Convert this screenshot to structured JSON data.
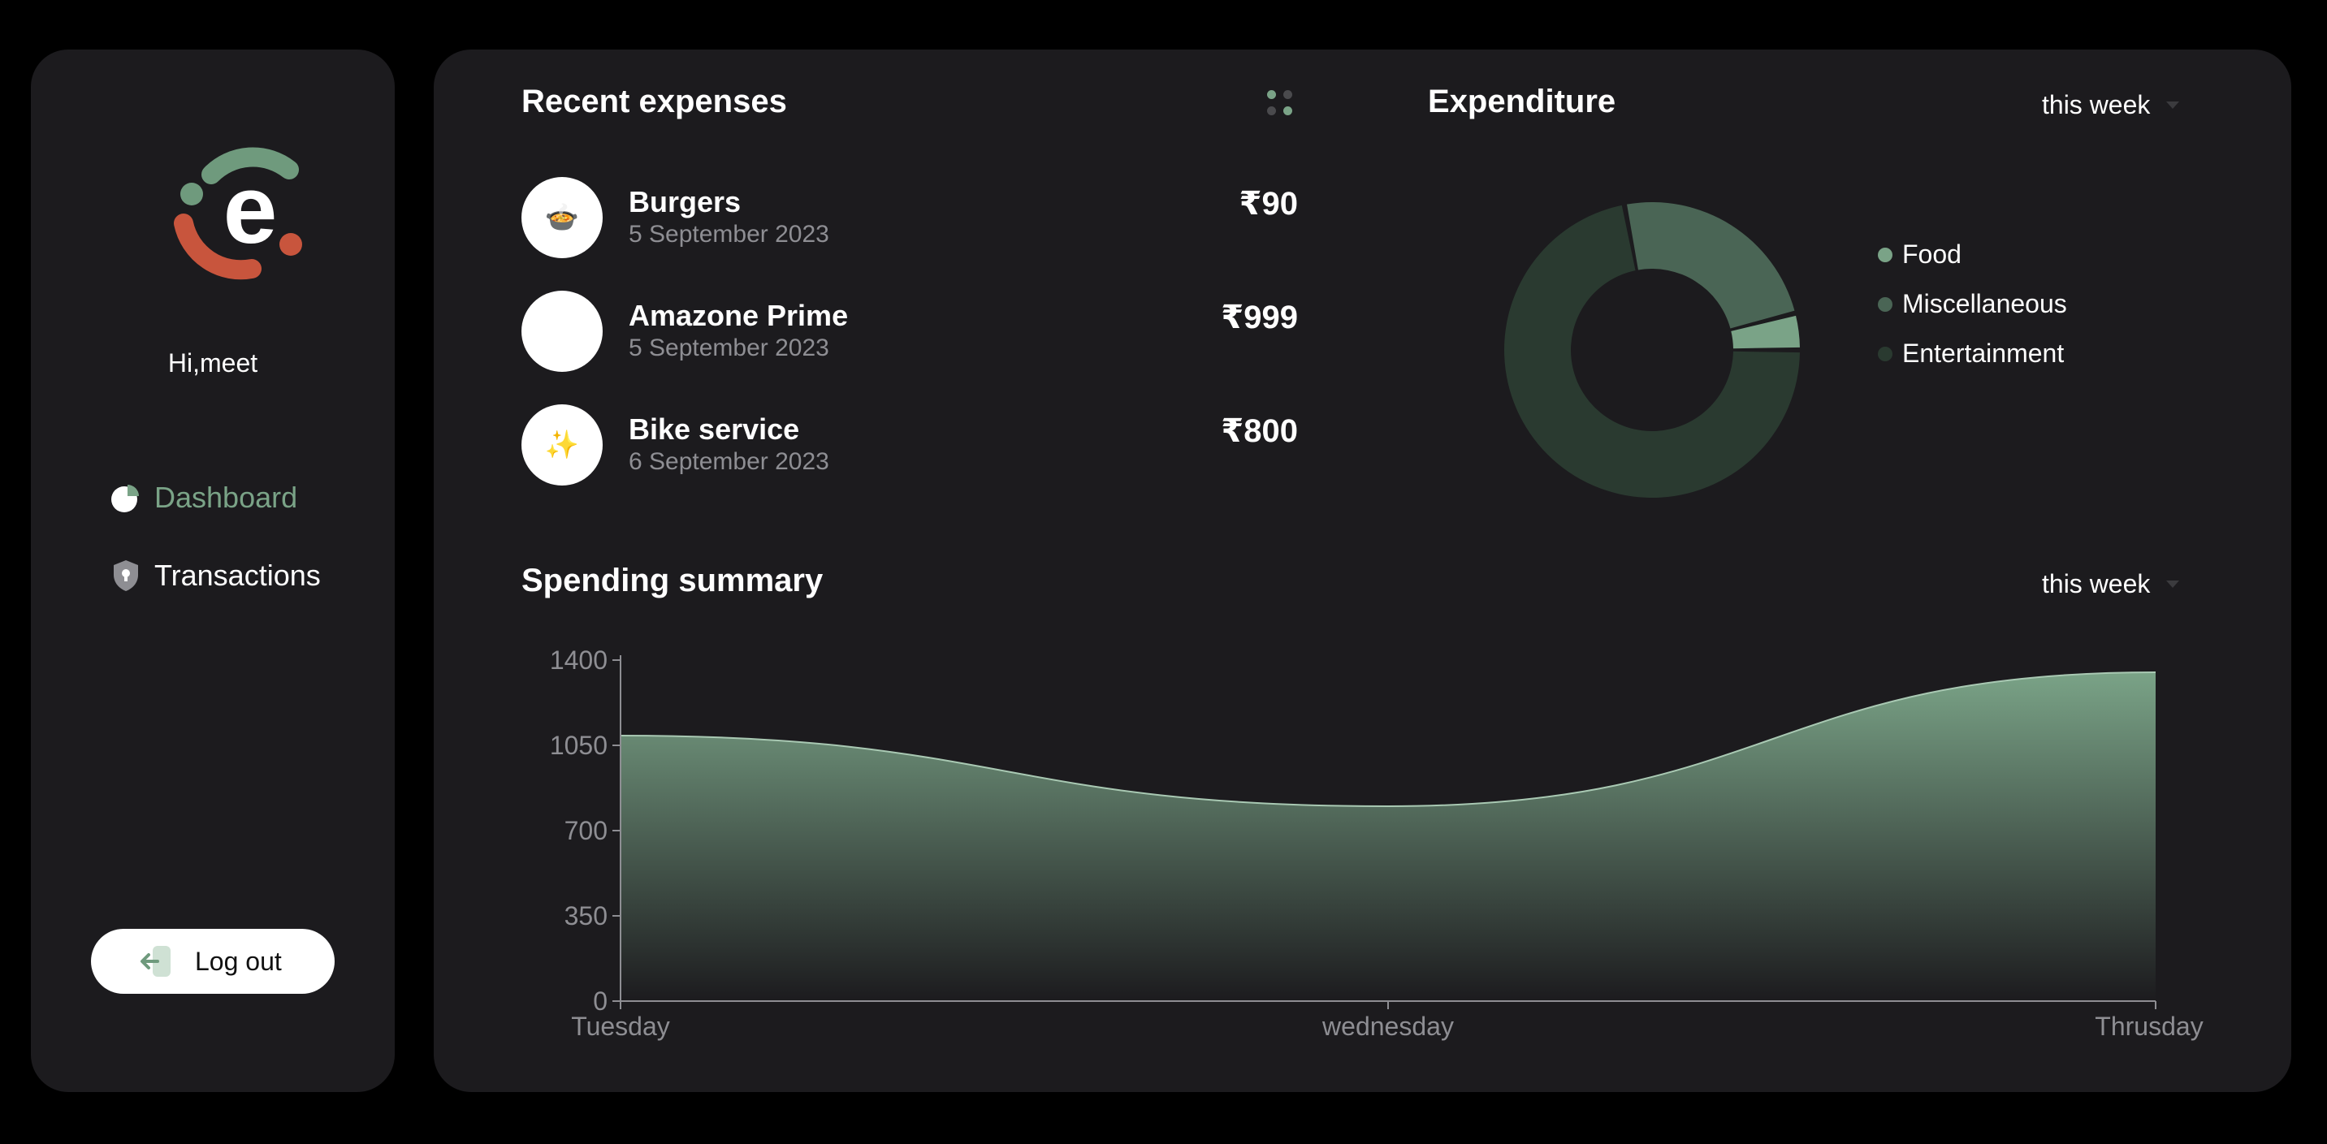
{
  "user": {
    "greeting": "Hi,meet"
  },
  "nav": {
    "items": [
      {
        "label": "Dashboard",
        "active": true,
        "icon": "pie-chart-icon"
      },
      {
        "label": "Transactions",
        "active": false,
        "icon": "shield-icon"
      }
    ]
  },
  "logout": {
    "label": "Log out",
    "icon": "logout-icon"
  },
  "recent_expenses": {
    "title": "Recent expenses",
    "items": [
      {
        "name": "Burgers",
        "date": "5 September 2023",
        "amount": "₹90",
        "icon": "🍲"
      },
      {
        "name": "Amazone Prime",
        "date": "5 September 2023",
        "amount": "₹999",
        "icon": "🎟"
      },
      {
        "name": "Bike service",
        "date": "6 September 2023",
        "amount": "₹800",
        "icon": "✨"
      }
    ]
  },
  "expenditure": {
    "title": "Expenditure",
    "period": "this week",
    "legend": [
      {
        "label": "Food",
        "color": "#7aa387"
      },
      {
        "label": "Miscellaneous",
        "color": "#4a6555"
      },
      {
        "label": "Entertainment",
        "color": "#2a3a30"
      }
    ]
  },
  "spending_summary": {
    "title": "Spending summary",
    "period": "this week"
  },
  "colors": {
    "accent": "#7aa387",
    "panel": "#1c1b1e",
    "background": "#000000"
  },
  "chart_data": [
    {
      "type": "pie",
      "labels": [
        "Food",
        "Miscellaneous",
        "Entertainment"
      ],
      "values": [
        4,
        24,
        72
      ],
      "colors": [
        "#7aa387",
        "#4a6555",
        "#2a3a30"
      ],
      "donut": true
    },
    {
      "type": "area",
      "x": [
        "Tuesday",
        "wednesday",
        "Thrusday"
      ],
      "values": [
        1090,
        800,
        1350
      ],
      "yticks": [
        0,
        350,
        700,
        1050,
        1400
      ],
      "ylim": [
        0,
        1400
      ],
      "grid": false,
      "colors": [
        "#7aa387"
      ]
    }
  ]
}
